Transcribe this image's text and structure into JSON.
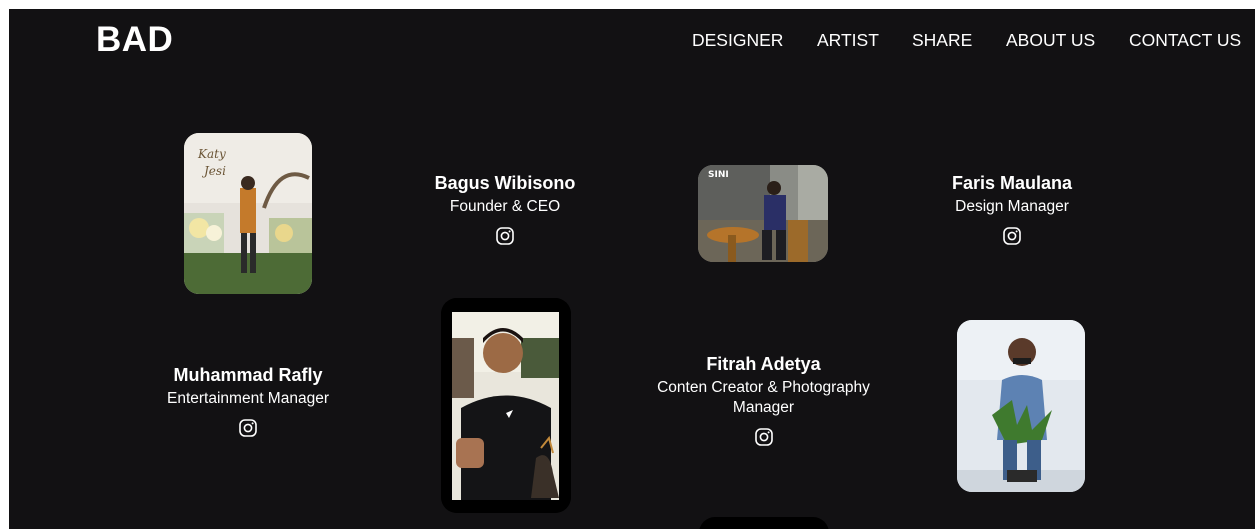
{
  "header": {
    "brand": "BAD",
    "nav": {
      "designer": "DESIGNER",
      "artist": "ARTIST",
      "share": "SHARE",
      "about": "ABOUT US",
      "contact": "CONTACT US"
    }
  },
  "team": [
    {
      "name": "Bagus Wibisono",
      "role": "Founder & CEO",
      "icon": "instagram-icon"
    },
    {
      "name": "Faris Maulana",
      "role": "Design Manager",
      "icon": "instagram-icon"
    },
    {
      "name": "Muhammad Rafly",
      "role": "Entertainment Manager",
      "icon": "instagram-icon"
    },
    {
      "name": "Fitrah Adetya",
      "role": "Conten Creator & Photography Manager",
      "icon": "instagram-icon"
    }
  ],
  "colors": {
    "background": "#121113",
    "text": "#ffffff"
  }
}
